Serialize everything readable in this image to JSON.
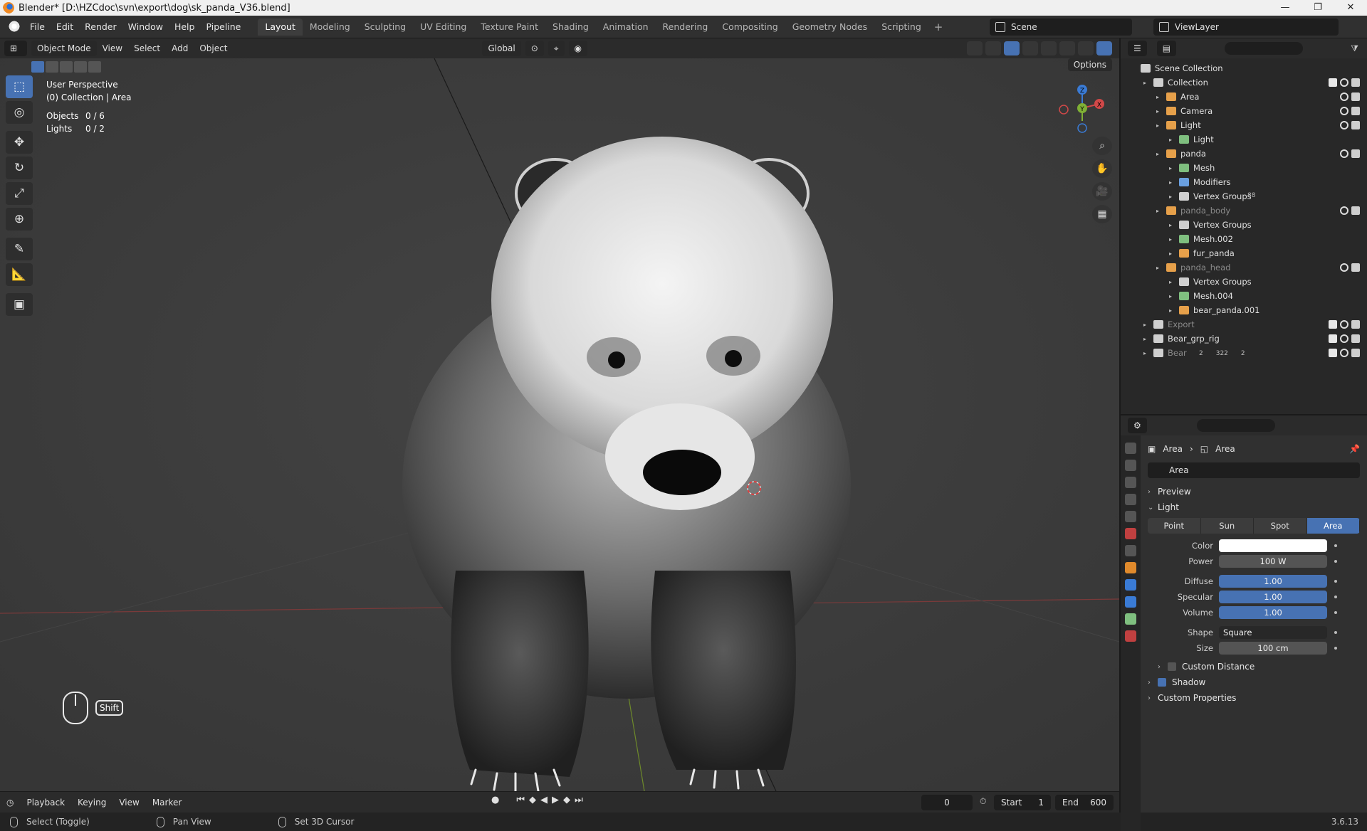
{
  "window": {
    "title": "Blender* [D:\\HZCdoc\\svn\\export\\dog\\sk_panda_V36.blend]",
    "buttons": [
      "—",
      "❐",
      "✕"
    ]
  },
  "menu": [
    "File",
    "Edit",
    "Render",
    "Window",
    "Help",
    "Pipeline"
  ],
  "workspaces": [
    "Layout",
    "Modeling",
    "Sculpting",
    "UV Editing",
    "Texture Paint",
    "Shading",
    "Animation",
    "Rendering",
    "Compositing",
    "Geometry Nodes",
    "Scripting"
  ],
  "workspace_plus": "+",
  "scene": "Scene",
  "view_layer": "ViewLayer",
  "viewport_header": {
    "mode": "Object Mode",
    "menus": [
      "View",
      "Select",
      "Add",
      "Object"
    ],
    "transform": "Global",
    "options": "Options"
  },
  "viewport": {
    "perspective": "User Perspective",
    "collection": "(0) Collection | Area",
    "stats": [
      {
        "label": "Objects",
        "value": "0 / 6"
      },
      {
        "label": "Lights",
        "value": "0 / 2"
      }
    ],
    "shift_key": "Shift",
    "gizmo_axis": [
      "X",
      "Y",
      "Z"
    ]
  },
  "outliner": {
    "rows": [
      {
        "label": "Scene Collection",
        "depth": 0,
        "icon": "collection-icon",
        "dim": false
      },
      {
        "label": "Collection",
        "depth": 1,
        "icon": "collection-icon",
        "dim": false
      },
      {
        "label": "Area",
        "depth": 2,
        "icon": "light-icon",
        "dim": false
      },
      {
        "label": "Camera",
        "depth": 2,
        "icon": "camera-icon",
        "dim": false
      },
      {
        "label": "Light",
        "depth": 2,
        "icon": "light-icon",
        "dim": false
      },
      {
        "label": "Light",
        "depth": 3,
        "icon": "light-data-icon",
        "dim": false
      },
      {
        "label": "panda",
        "depth": 2,
        "icon": "mesh-object-icon",
        "dim": false
      },
      {
        "label": "Mesh",
        "depth": 3,
        "icon": "mesh-icon",
        "dim": false
      },
      {
        "label": "Modifiers",
        "depth": 3,
        "icon": "wrench-icon",
        "dim": false
      },
      {
        "label": "Vertex Groups",
        "depth": 3,
        "icon": "vertex-groups-icon",
        "dim": false
      },
      {
        "label": "panda_body",
        "depth": 2,
        "icon": "mesh-object-icon",
        "dim": true
      },
      {
        "label": "Vertex Groups",
        "depth": 3,
        "icon": "vertex-groups-icon",
        "dim": false
      },
      {
        "label": "Mesh.002",
        "depth": 3,
        "icon": "mesh-icon",
        "dim": false
      },
      {
        "label": "fur_panda",
        "depth": 3,
        "icon": "hair-icon",
        "dim": false
      },
      {
        "label": "panda_head",
        "depth": 2,
        "icon": "mesh-object-icon",
        "dim": true
      },
      {
        "label": "Vertex Groups",
        "depth": 3,
        "icon": "vertex-groups-icon",
        "dim": false
      },
      {
        "label": "Mesh.004",
        "depth": 3,
        "icon": "mesh-icon",
        "dim": false
      },
      {
        "label": "bear_panda.001",
        "depth": 3,
        "icon": "hair-icon",
        "dim": false
      },
      {
        "label": "Export",
        "depth": 1,
        "icon": "collection-icon",
        "dim": true
      },
      {
        "label": "Bear_grp_rig",
        "depth": 1,
        "icon": "collection-icon",
        "dim": false
      },
      {
        "label": "Bear",
        "depth": 1,
        "icon": "collection-icon",
        "dim": true
      }
    ],
    "bear_counts": [
      "2",
      "322",
      "2"
    ],
    "vertex_group_count": "88"
  },
  "properties": {
    "breadcrumb": [
      "Area",
      "Area"
    ],
    "data_name": "Area",
    "sections": {
      "preview": "Preview",
      "light": "Light",
      "custom_distance": "Custom Distance",
      "shadow": "Shadow",
      "custom_properties": "Custom Properties"
    },
    "light_types": [
      "Point",
      "Sun",
      "Spot",
      "Area"
    ],
    "active_type": "Area",
    "fields": {
      "color_label": "Color",
      "power_label": "Power",
      "power": "100 W",
      "diffuse_label": "Diffuse",
      "diffuse": "1.00",
      "specular_label": "Specular",
      "specular": "1.00",
      "volume_label": "Volume",
      "volume": "1.00",
      "shape_label": "Shape",
      "shape": "Square",
      "size_label": "Size",
      "size": "100 cm"
    },
    "shadow_enabled": true,
    "colors": {
      "accent": "#4772b3",
      "light_color": "#ffffff"
    }
  },
  "timeline": {
    "menus": [
      "Playback",
      "Keying",
      "View",
      "Marker"
    ],
    "current_frame": "0",
    "start_label": "Start",
    "start": "1",
    "end_label": "End",
    "end": "600"
  },
  "status": {
    "items": [
      "Select (Toggle)",
      "Pan View",
      "Set 3D Cursor"
    ],
    "version": "3.6.13"
  }
}
